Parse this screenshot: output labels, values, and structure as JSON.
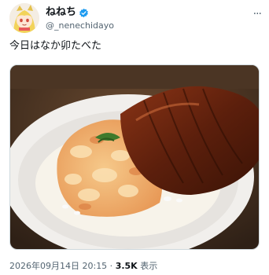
{
  "author": {
    "display_name": "ねねち",
    "handle": "@_nenechidayo",
    "avatar_icon": "avatar-anime-girl",
    "verified_icon": "verified-badge-icon",
    "verified_color": "#1d9bf0"
  },
  "tweet": {
    "text": "今日はなか卯たべた",
    "media_description_icon": "food-photo-oyakodon-unagi",
    "timestamp": "2026年09月14日 20:15",
    "separator": " · ",
    "views_count": "3.5K",
    "views_label": "表示"
  },
  "menu": {
    "more_label": "···"
  }
}
